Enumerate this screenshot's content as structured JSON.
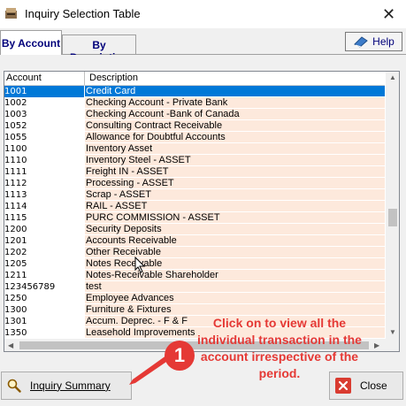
{
  "window": {
    "title": "Inquiry Selection Table"
  },
  "tabs": [
    {
      "label": "By Account",
      "active": true
    },
    {
      "label": "By Description",
      "active": false
    }
  ],
  "help": {
    "label": "Help",
    "icon": "book-icon"
  },
  "table": {
    "columns": [
      "Account",
      "Description"
    ],
    "selected_account": "1001",
    "rows": [
      {
        "account": "1001",
        "description": "Credit Card"
      },
      {
        "account": "1002",
        "description": "Checking Account - Private Bank"
      },
      {
        "account": "1003",
        "description": "Checking Account -Bank of Canada"
      },
      {
        "account": "1052",
        "description": "Consulting Contract Receivable"
      },
      {
        "account": "1055",
        "description": "Allowance for Doubtful Accounts"
      },
      {
        "account": "1100",
        "description": "Inventory Asset"
      },
      {
        "account": "1110",
        "description": "Inventory Steel - ASSET"
      },
      {
        "account": "1111",
        "description": "Freight IN - ASSET"
      },
      {
        "account": "1112",
        "description": "Processing - ASSET"
      },
      {
        "account": "1113",
        "description": "Scrap - ASSET"
      },
      {
        "account": "1114",
        "description": "RAIL - ASSET"
      },
      {
        "account": "1115",
        "description": "PURC COMMISSION - ASSET"
      },
      {
        "account": "1200",
        "description": "Security Deposits"
      },
      {
        "account": "1201",
        "description": "Accounts Receivable"
      },
      {
        "account": "1202",
        "description": "Other Receivable"
      },
      {
        "account": "1205",
        "description": "Notes Receivable"
      },
      {
        "account": "1211",
        "description": "Notes-Receivable Shareholder"
      },
      {
        "account": "123456789",
        "description": "test"
      },
      {
        "account": "1250",
        "description": "Employee Advances"
      },
      {
        "account": "1300",
        "description": "Furniture & Fixtures"
      },
      {
        "account": "1301",
        "description": "Accum. Deprec. - F & F"
      },
      {
        "account": "1350",
        "description": "Leasehold Improvements"
      }
    ]
  },
  "buttons": {
    "inquiry_summary": {
      "label": "Inquiry Summary",
      "icon": "magnifier-icon"
    },
    "close": {
      "label": "Close",
      "icon": "close-x-icon"
    }
  },
  "annotation": {
    "badge": "1",
    "text": "Click on to view all the individual transaction in the account irrespective of the period.",
    "color": "#e53935"
  },
  "colors": {
    "selection": "#0078d7",
    "row_tint": "#fde9dc",
    "tab_text": "#00007a"
  }
}
